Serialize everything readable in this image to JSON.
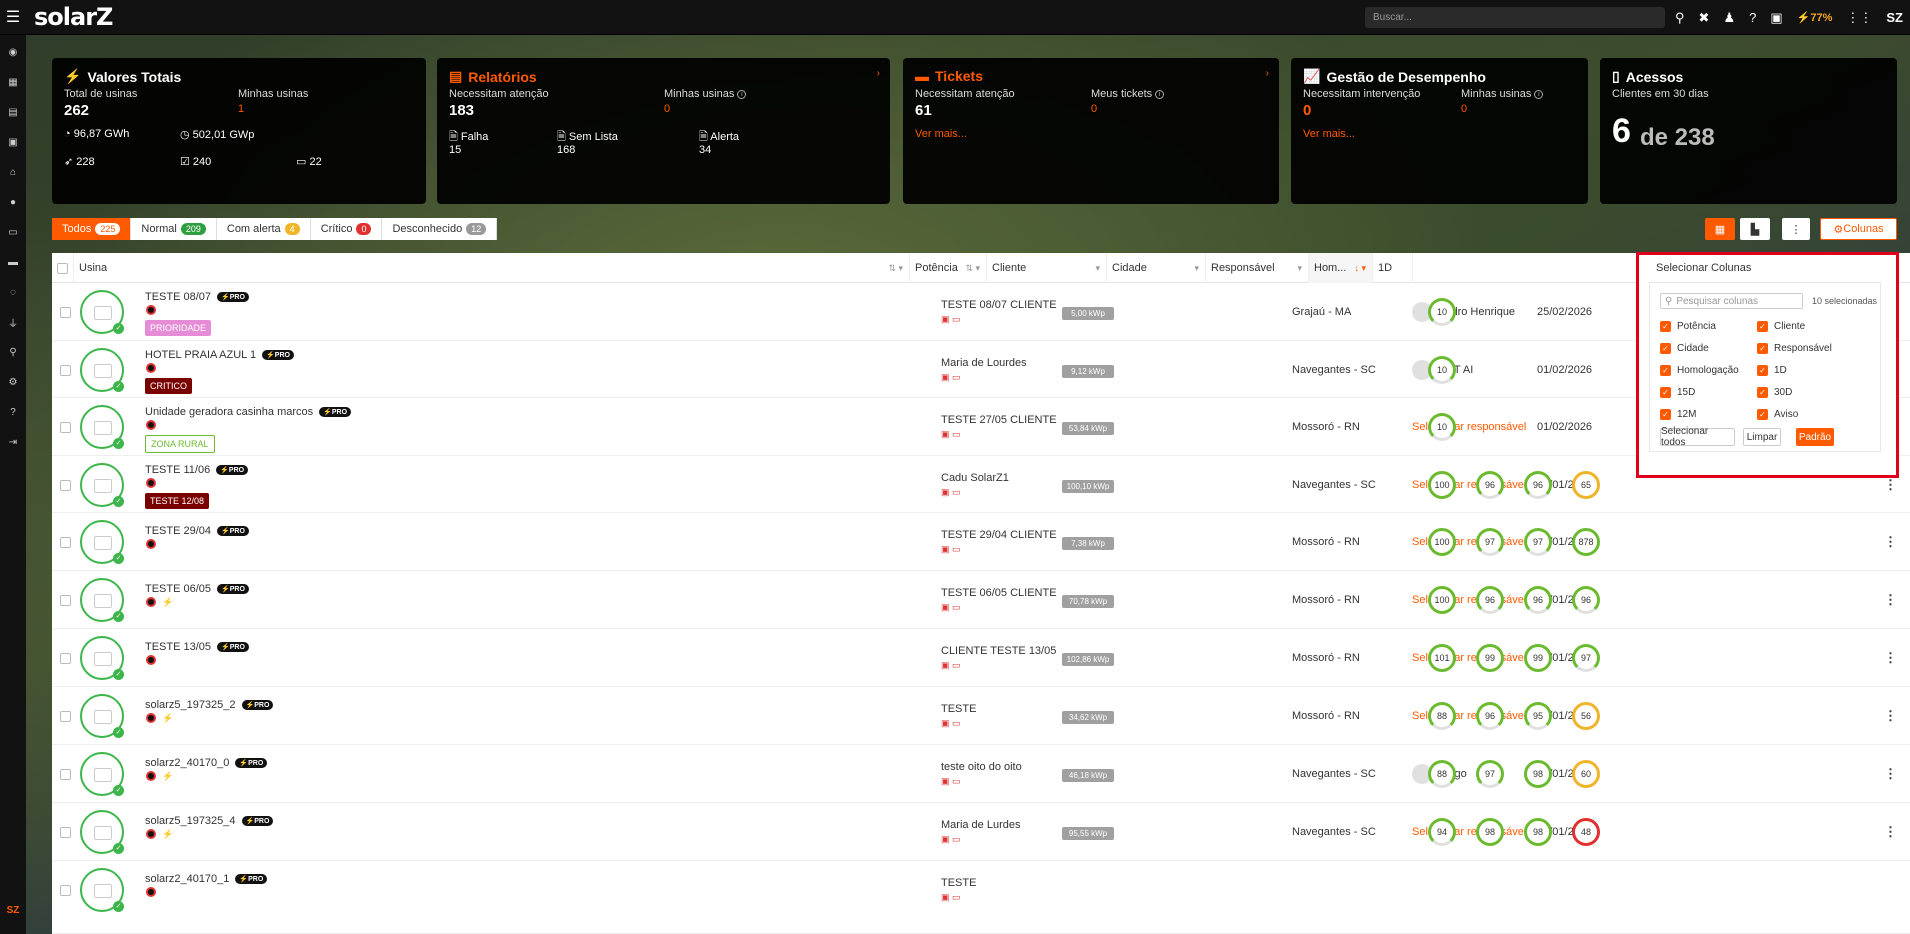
{
  "app": {
    "logo": "solarZ",
    "search_placeholder": "Buscar...",
    "battery": "77%",
    "footer_logo": "SZ"
  },
  "cards": {
    "valores": {
      "title": "Valores Totais",
      "total_label": "Total de usinas",
      "total_value": "262",
      "minhas_label": "Minhas usinas",
      "minhas_value": "1",
      "energy": "96,87 GWh",
      "power": "502,01 GWp",
      "c1": "228",
      "c2": "240",
      "c3": "22"
    },
    "relatorios": {
      "title": "Relatórios",
      "atencao_label": "Necessitam atenção",
      "atencao_value": "183",
      "minhas_label": "Minhas usinas",
      "minhas_value": "0",
      "falha_label": "Falha",
      "falha_value": "15",
      "semlista_label": "Sem Lista",
      "semlista_value": "168",
      "alerta_label": "Alerta",
      "alerta_value": "34"
    },
    "tickets": {
      "title": "Tickets",
      "atencao_label": "Necessitam atenção",
      "atencao_value": "61",
      "meus_label": "Meus tickets",
      "meus_value": "0",
      "link": "Ver mais..."
    },
    "gestao": {
      "title": "Gestão de Desempenho",
      "interv_label": "Necessitam intervenção",
      "interv_value": "0",
      "minhas_label": "Minhas usinas",
      "minhas_value": "0",
      "link": "Ver mais..."
    },
    "acessos": {
      "title": "Acessos",
      "sub": "Clientes em 30 dias",
      "value": "6",
      "of": "de 238"
    }
  },
  "filters": [
    {
      "label": "Todos",
      "count": "225",
      "color": "#fff"
    },
    {
      "label": "Normal",
      "count": "209",
      "color": "#2e9e3e"
    },
    {
      "label": "Com alerta",
      "count": "4",
      "color": "#f0b429"
    },
    {
      "label": "Crítico",
      "count": "0",
      "color": "#e03030"
    },
    {
      "label": "Desconhecido",
      "count": "12",
      "color": "#999"
    }
  ],
  "toolbar": {
    "colunas_label": "Colunas"
  },
  "columns": {
    "usina": "Usina",
    "potencia": "Potência",
    "cliente": "Cliente",
    "cidade": "Cidade",
    "responsavel": "Responsável",
    "hom": "Hom...",
    "d1": "1D"
  },
  "rows": [
    {
      "name": "TESTE 08/07",
      "tag": "PRIORIDADE",
      "kwp": "5,00 kWp",
      "cliente": "TESTE 08/07 CLIENTE",
      "cidade": "Grajaú - MA",
      "resp": "Pedro Henrique",
      "hom": "25/02/2026",
      "r1": "10"
    },
    {
      "name": "HOTEL PRAIA AZUL 1",
      "tag": "CRITICO",
      "kwp": "9,12 kWp",
      "cliente": "Maria de Lourdes",
      "cidade": "Navegantes - SC",
      "resp": "BOT AI",
      "hom": "01/02/2026",
      "r1": "10"
    },
    {
      "name": "Unidade geradora casinha marcos",
      "tag": "ZONA RURAL",
      "kwp": "53,84 kWp",
      "cliente": "TESTE 27/05 CLIENTE",
      "cidade": "Mossoró - RN",
      "resp": "Selecionar responsável",
      "hom": "01/02/2026",
      "r1": "10"
    },
    {
      "name": "TESTE 11/06",
      "tag": "TESTE 12/08",
      "kwp": "100,10 kWp",
      "cliente": "Cadu SolarZ1",
      "cidade": "Navegantes - SC",
      "resp": "Selecionar responsável",
      "hom": "01/01/2026",
      "r1": "100",
      "r2": "96",
      "r3": "96",
      "r4": "65"
    },
    {
      "name": "TESTE 29/04",
      "kwp": "7,38 kWp",
      "cliente": "TESTE 29/04 CLIENTE",
      "cidade": "Mossoró - RN",
      "resp": "Selecionar responsável",
      "hom": "01/01/2026",
      "r1": "100",
      "r2": "97",
      "r3": "97",
      "r4": "878"
    },
    {
      "name": "TESTE 06/05",
      "kwp": "70,78 kWp",
      "cliente": "TESTE 06/05 CLIENTE",
      "cidade": "Mossoró - RN",
      "resp": "Selecionar responsável",
      "hom": "01/01/2026",
      "r1": "100",
      "r2": "96",
      "r3": "96",
      "r4": "96"
    },
    {
      "name": "TESTE 13/05",
      "kwp": "102,86 kWp",
      "cliente": "CLIENTE TESTE 13/05",
      "cidade": "Mossoró - RN",
      "resp": "Selecionar responsável",
      "hom": "01/01/2026",
      "r1": "101",
      "r2": "99",
      "r3": "99",
      "r4": "97"
    },
    {
      "name": "solarz5_197325_2",
      "kwp": "34,62 kWp",
      "cliente": "TESTE",
      "cidade": "Mossoró - RN",
      "resp": "Selecionar responsável",
      "hom": "01/01/2026",
      "r1": "88",
      "r2": "96",
      "r3": "95",
      "r4": "56"
    },
    {
      "name": "solarz2_40170_0",
      "kwp": "46,18 kWp",
      "cliente": "teste oito do oito",
      "cidade": "Navegantes - SC",
      "resp": "Diêgo",
      "hom": "01/01/2026",
      "r1": "88",
      "r2": "97",
      "r3": "98",
      "r4": "60"
    },
    {
      "name": "solarz5_197325_4",
      "kwp": "95,55 kWp",
      "cliente": "Maria de Lurdes",
      "cidade": "Navegantes - SC",
      "resp": "Selecionar responsável",
      "hom": "01/01/2026",
      "r1": "94",
      "r2": "98",
      "r3": "98",
      "r4": "48"
    },
    {
      "name": "solarz2_40170_1",
      "cliente": "TESTE"
    }
  ],
  "popover": {
    "title": "Selecionar Colunas",
    "search_placeholder": "Pesquisar colunas",
    "count": "10 selecionadas",
    "options": [
      "Potência",
      "Cliente",
      "Cidade",
      "Responsável",
      "Homologação",
      "1D",
      "15D",
      "30D",
      "12M",
      "Aviso"
    ],
    "select_all": "Selecionar todos",
    "clear": "Limpar",
    "default": "Padrão"
  }
}
